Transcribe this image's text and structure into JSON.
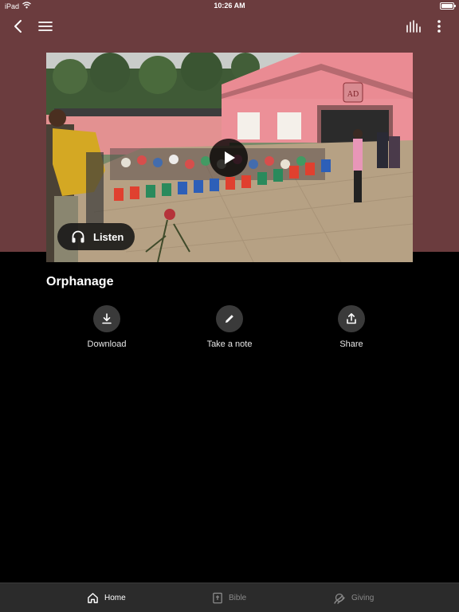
{
  "status_bar": {
    "device": "iPad",
    "time": "10:26 AM"
  },
  "header": {
    "back_icon": "chevron-left-icon",
    "menu_icon": "hamburger-icon",
    "audio_icon": "audio-bars-icon",
    "more_icon": "vertical-dots-icon"
  },
  "media": {
    "listen_label": "Listen",
    "listen_icon": "headphones-icon",
    "play_icon": "play-icon",
    "sign_text": "AD"
  },
  "content": {
    "title": "Orphanage",
    "actions": [
      {
        "label": "Download",
        "icon": "download-icon"
      },
      {
        "label": "Take a note",
        "icon": "pencil-icon"
      },
      {
        "label": "Share",
        "icon": "share-icon"
      }
    ]
  },
  "tab_bar": {
    "tabs": [
      {
        "label": "Home",
        "icon": "home-icon",
        "active": true
      },
      {
        "label": "Bible",
        "icon": "bible-icon",
        "active": false
      },
      {
        "label": "Giving",
        "icon": "giving-icon",
        "active": false
      }
    ]
  },
  "colors": {
    "header_background": "#6b3c3e",
    "page_background": "#000000",
    "tab_bar_background": "#2b2b2b",
    "active_tab": "#ffffff",
    "inactive_tab": "#8a8a8a"
  }
}
